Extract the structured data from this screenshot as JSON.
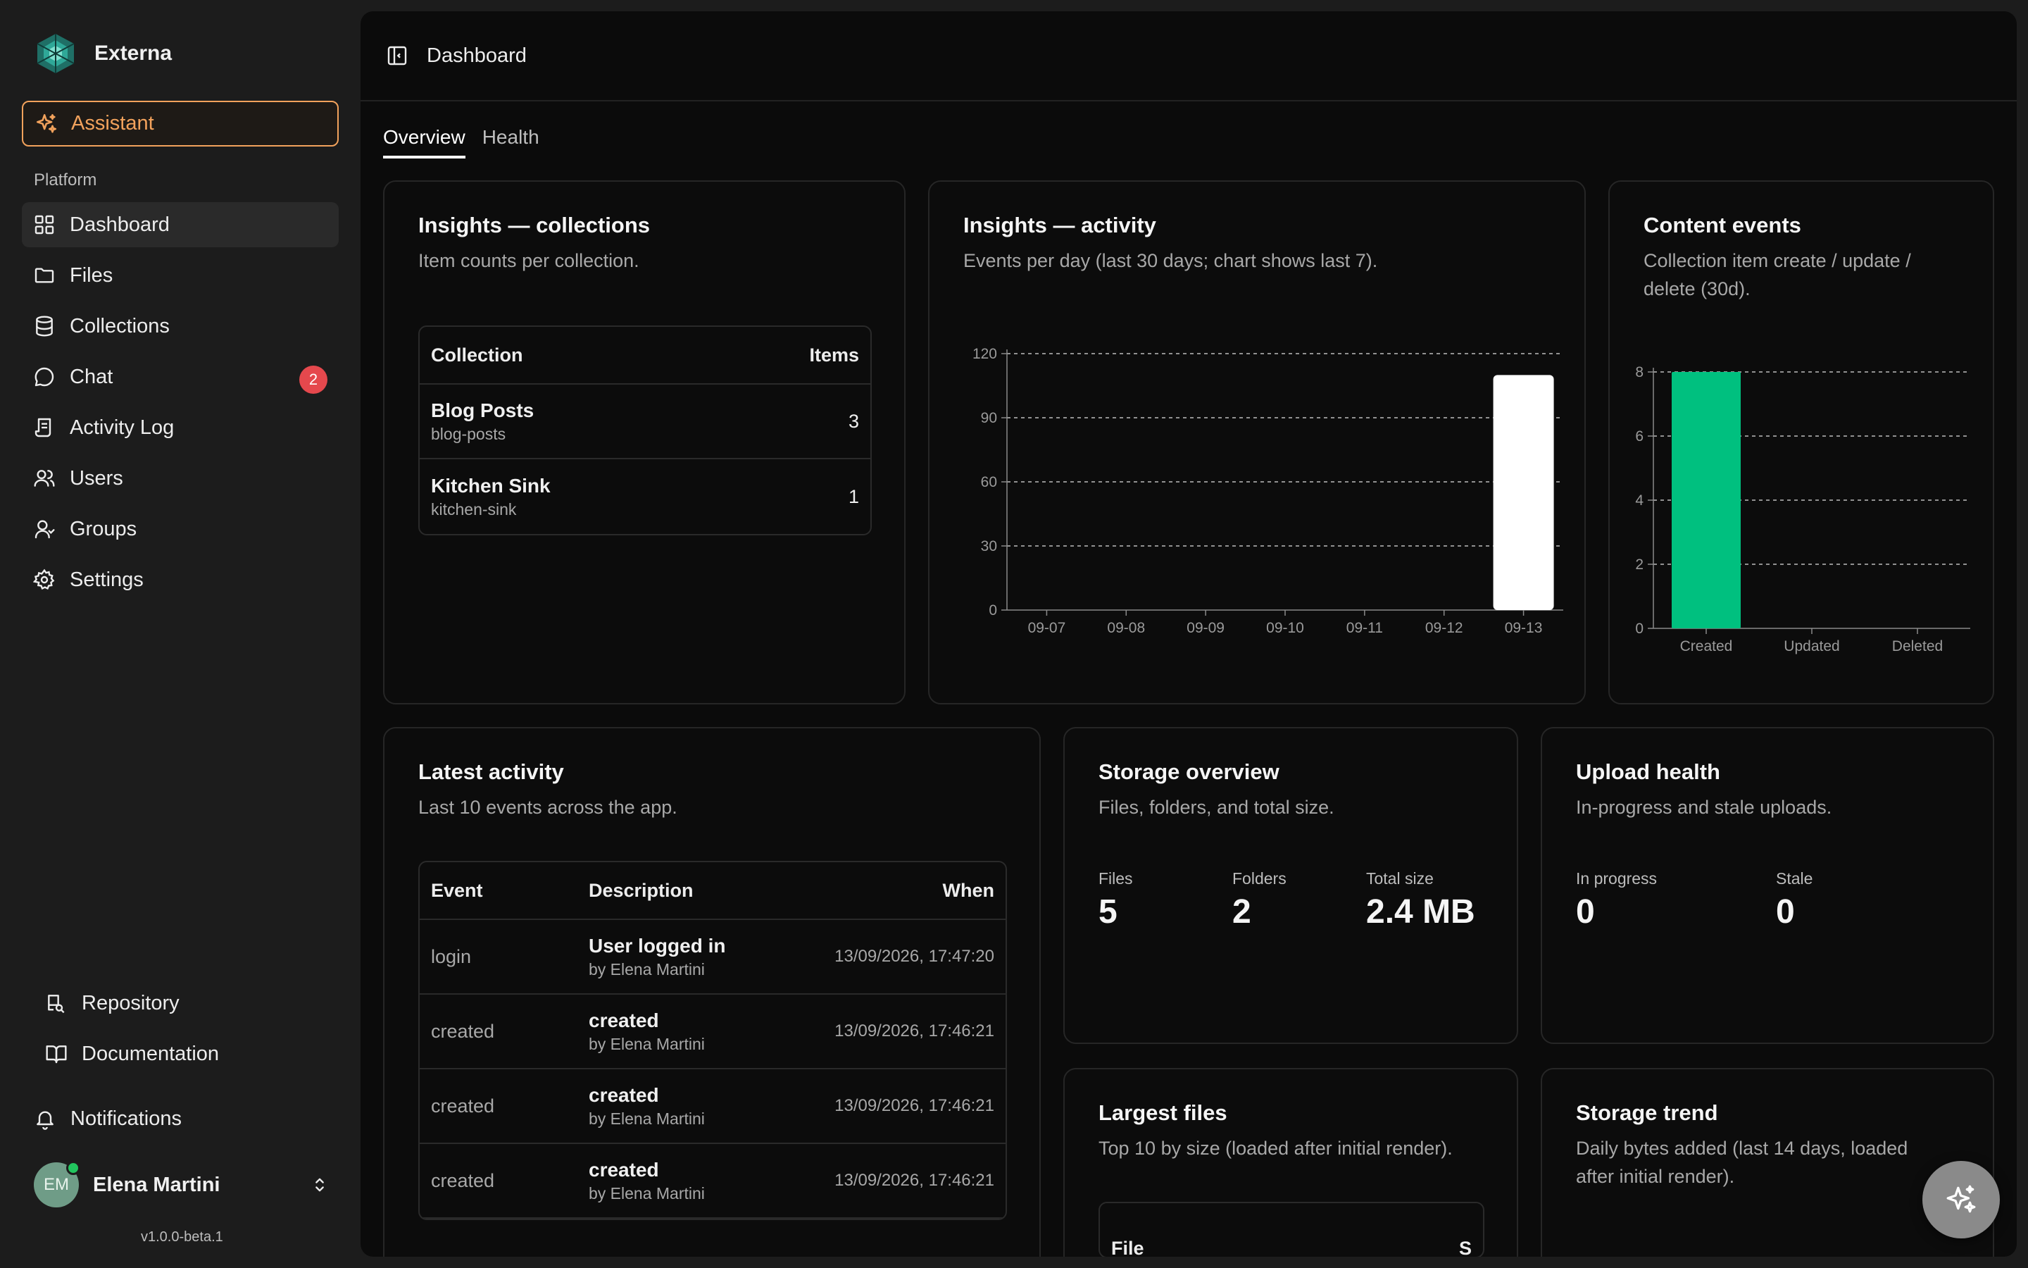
{
  "app": {
    "name": "Externa",
    "version": "v1.0.0-beta.1"
  },
  "sidebar": {
    "assistant_label": "Assistant",
    "section_label": "Platform",
    "items": [
      {
        "label": "Dashboard",
        "icon": "dashboard-icon",
        "active": true
      },
      {
        "label": "Files",
        "icon": "folder-icon"
      },
      {
        "label": "Collections",
        "icon": "database-icon"
      },
      {
        "label": "Chat",
        "icon": "chat-icon",
        "badge": "2"
      },
      {
        "label": "Activity Log",
        "icon": "log-icon"
      },
      {
        "label": "Users",
        "icon": "users-icon"
      },
      {
        "label": "Groups",
        "icon": "group-icon"
      },
      {
        "label": "Settings",
        "icon": "gear-icon"
      }
    ],
    "bottom_links": [
      {
        "label": "Repository",
        "icon": "repository-icon"
      },
      {
        "label": "Documentation",
        "icon": "book-icon"
      }
    ],
    "notifications_label": "Notifications",
    "user": {
      "initials": "EM",
      "name": "Elena Martini"
    }
  },
  "header": {
    "title": "Dashboard"
  },
  "tabs": [
    {
      "label": "Overview",
      "active": true
    },
    {
      "label": "Health"
    }
  ],
  "collections_card": {
    "title": "Insights — collections",
    "subtitle": "Item counts per collection.",
    "headers": {
      "name": "Collection",
      "items": "Items"
    },
    "rows": [
      {
        "name": "Blog Posts",
        "slug": "blog-posts",
        "count": "3"
      },
      {
        "name": "Kitchen Sink",
        "slug": "kitchen-sink",
        "count": "1"
      }
    ]
  },
  "activity_card": {
    "title": "Insights — activity",
    "subtitle": "Events per day (last 30 days; chart shows last 7)."
  },
  "content_card": {
    "title": "Content events",
    "subtitle_line1": "Collection item create / update /",
    "subtitle_line2": "delete (30d)."
  },
  "chart_data": [
    {
      "type": "bar",
      "categories": [
        "09-07",
        "09-08",
        "09-09",
        "09-10",
        "09-11",
        "09-12",
        "09-13"
      ],
      "values": [
        0,
        0,
        0,
        0,
        0,
        0,
        110
      ],
      "yticks": [
        0,
        30,
        60,
        90,
        120
      ],
      "ylim": [
        0,
        120
      ],
      "grid": true,
      "color": "#ffffff"
    },
    {
      "type": "bar",
      "categories": [
        "Created",
        "Updated",
        "Deleted"
      ],
      "values": [
        8,
        0,
        0
      ],
      "yticks": [
        0,
        2,
        4,
        6,
        8
      ],
      "ylim": [
        0,
        8
      ],
      "grid": true,
      "color": "#00c07f"
    }
  ],
  "latest_activity": {
    "title": "Latest activity",
    "subtitle": "Last 10 events across the app.",
    "headers": {
      "event": "Event",
      "description": "Description",
      "when": "When"
    },
    "rows": [
      {
        "event": "login",
        "desc": "User logged in",
        "by": "by Elena Martini",
        "when": "13/09/2026, 17:47:20"
      },
      {
        "event": "created",
        "desc": "created",
        "by": "by Elena Martini",
        "when": "13/09/2026, 17:46:21"
      },
      {
        "event": "created",
        "desc": "created",
        "by": "by Elena Martini",
        "when": "13/09/2026, 17:46:21"
      },
      {
        "event": "created",
        "desc": "created",
        "by": "by Elena Martini",
        "when": "13/09/2026, 17:46:21"
      }
    ]
  },
  "storage_overview": {
    "title": "Storage overview",
    "subtitle": "Files, folders, and total size.",
    "stats": [
      {
        "label": "Files",
        "value": "5"
      },
      {
        "label": "Folders",
        "value": "2"
      },
      {
        "label": "Total size",
        "value": "2.4 MB"
      }
    ]
  },
  "upload_health": {
    "title": "Upload health",
    "subtitle": "In-progress and stale uploads.",
    "stats": [
      {
        "label": "In progress",
        "value": "0"
      },
      {
        "label": "Stale",
        "value": "0"
      }
    ]
  },
  "largest_files": {
    "title": "Largest files",
    "subtitle": "Top 10 by size (loaded after initial render).",
    "header_file": "File",
    "header_size": "S"
  },
  "storage_trend": {
    "title": "Storage trend",
    "subtitle_line1": "Daily bytes added (last 14 days, loaded",
    "subtitle_line2": "after initial render)."
  }
}
